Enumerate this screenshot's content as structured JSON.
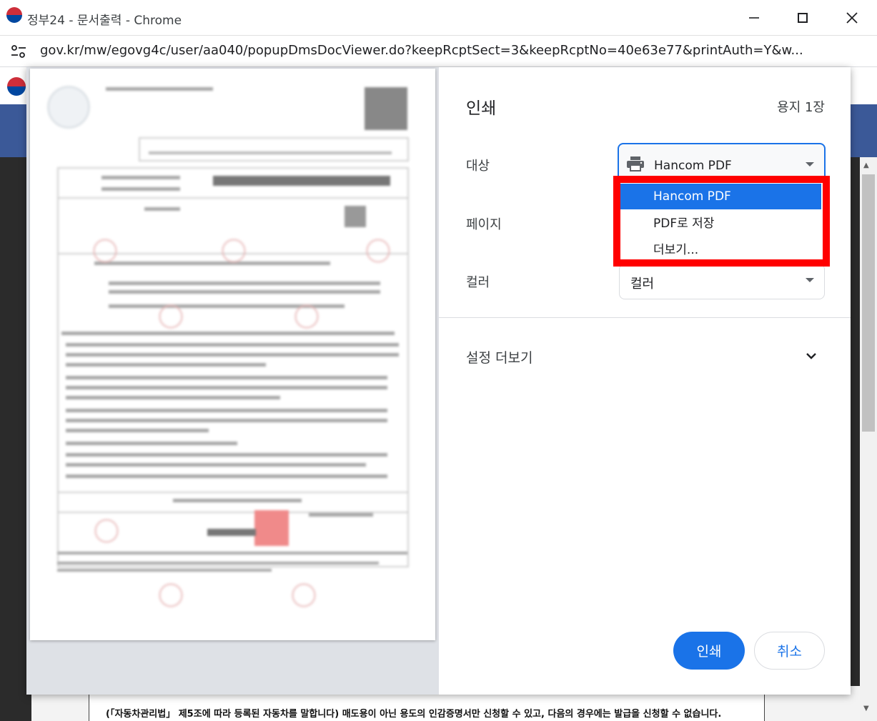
{
  "window": {
    "title": "정부24 - 문서출력 - Chrome",
    "url": "gov.kr/mw/egovg4c/user/aa040/popupDmsDocViewer.do?keepRcptSect=3&keepRcptNo=40e63e77&printAuth=Y&w..."
  },
  "print_dialog": {
    "title": "인쇄",
    "sheet_count": "용지 1장",
    "labels": {
      "destination": "대상",
      "pages": "페이지",
      "color": "컬러"
    },
    "destination_value": "Hancom PDF",
    "color_value": "컬러",
    "more_settings": "설정 더보기",
    "print_button": "인쇄",
    "cancel_button": "취소",
    "destination_menu": {
      "items": [
        "Hancom PDF",
        "PDF로 저장",
        "더보기..."
      ],
      "selected": "Hancom PDF"
    },
    "highlight_color": "#ff0000",
    "accent_color": "#1a73e8"
  },
  "background_page": {
    "text_line_1": "(「자동차관리법」 제5조에 따라 등록된 자동차를 말합니다) 매도용이 아닌 용도의 인감증명서만 신청할 수 있고, 다음의 경우에는 발급을 신청할 수 없습니다."
  },
  "icons": {
    "site_logo": "taegeuk-icon",
    "site_info": "tune-icon",
    "printer": "printer-icon",
    "expand": "chevron-down-icon",
    "minimize": "minimize-icon",
    "maximize": "maximize-icon",
    "close": "close-icon"
  }
}
